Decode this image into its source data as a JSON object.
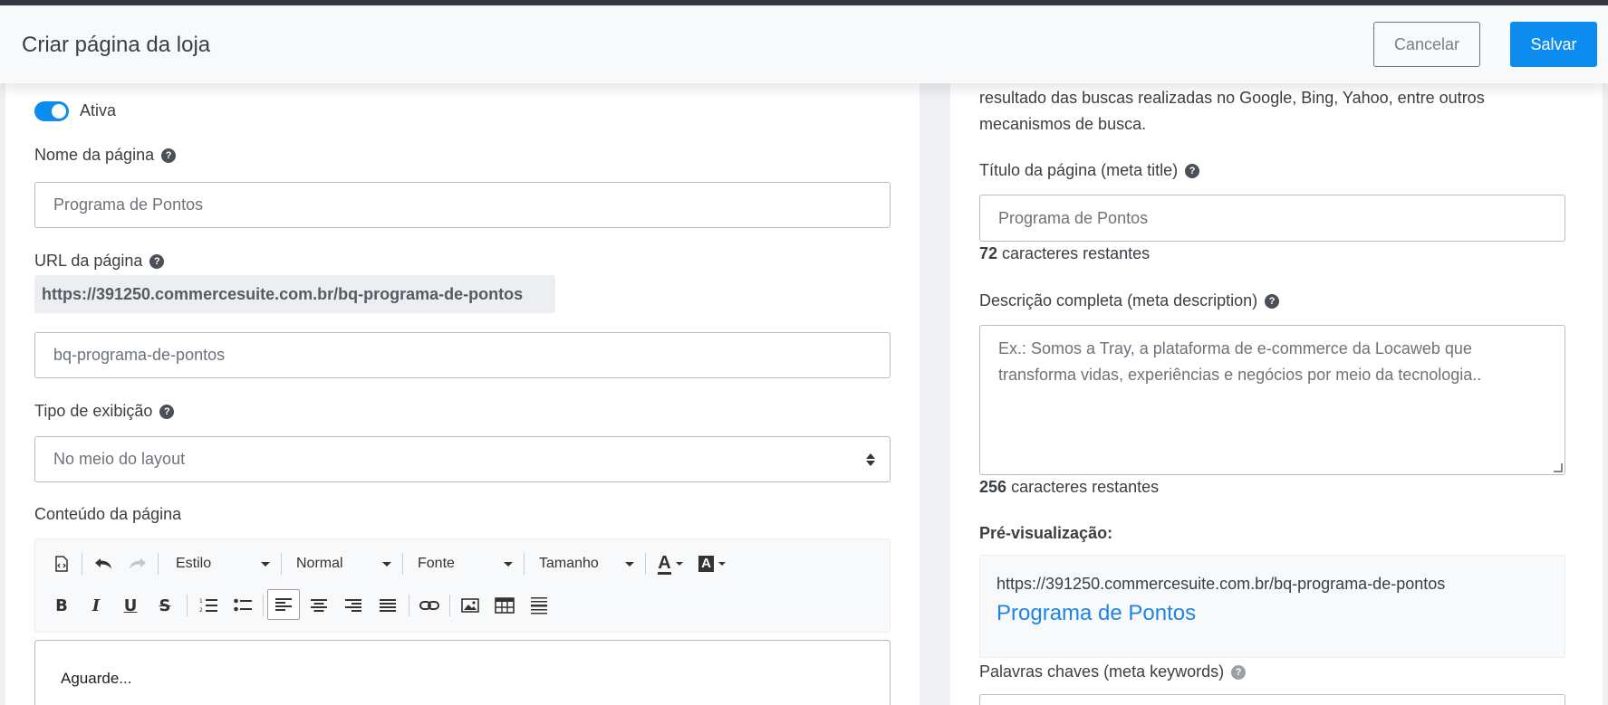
{
  "header": {
    "title": "Criar página da loja",
    "cancel_label": "Cancelar",
    "save_label": "Salvar"
  },
  "left": {
    "active_toggle": {
      "label": "Ativa",
      "on": true
    },
    "page_name": {
      "label": "Nome da página",
      "placeholder": "Programa de Pontos"
    },
    "page_url": {
      "label": "URL da página",
      "full_url": "https://391250.commercesuite.com.br/bq-programa-de-pontos",
      "slug_placeholder": "bq-programa-de-pontos"
    },
    "display_type": {
      "label": "Tipo de exibição",
      "selected": "No meio do layout"
    },
    "content": {
      "label": "Conteúdo da página",
      "editor_status": "Aguarde..."
    },
    "toolbar": {
      "style_label": "Estilo",
      "format_label": "Normal",
      "font_label": "Fonte",
      "size_label": "Tamanho",
      "bold": "B",
      "italic": "I",
      "underline": "U",
      "strike": "S",
      "text_color_glyph": "A",
      "bg_color_glyph": "A"
    }
  },
  "right": {
    "intro_line1": "resultado das buscas realizadas no Google, Bing, Yahoo, entre outros",
    "intro_line2": "mecanismos de busca.",
    "meta_title": {
      "label": "Título da página (meta title)",
      "placeholder": "Programa de Pontos",
      "remaining_count": "72",
      "remaining_text": "caracteres restantes"
    },
    "meta_description": {
      "label": "Descrição completa (meta description)",
      "placeholder": "Ex.: Somos a Tray, a plataforma de e-commerce da Locaweb que transforma vidas, experiências e negócios por meio da tecnologia..",
      "placeholder_line1": "Ex.: Somos a Tray, a plataforma de e-commerce da Locaweb que",
      "placeholder_line2": "transforma vidas, experiências e negócios por meio da tecnologia..",
      "remaining_count": "256",
      "remaining_text": "caracteres restantes"
    },
    "preview": {
      "label": "Pré-visualização:",
      "url": "https://391250.commercesuite.com.br/bq-programa-de-pontos",
      "title": "Programa de Pontos"
    },
    "meta_keywords": {
      "label": "Palavras chaves (meta keywords)"
    }
  },
  "colors": {
    "primary": "#0d8cf0",
    "preview_link": "#1f84e6",
    "topbar": "#343a40"
  }
}
